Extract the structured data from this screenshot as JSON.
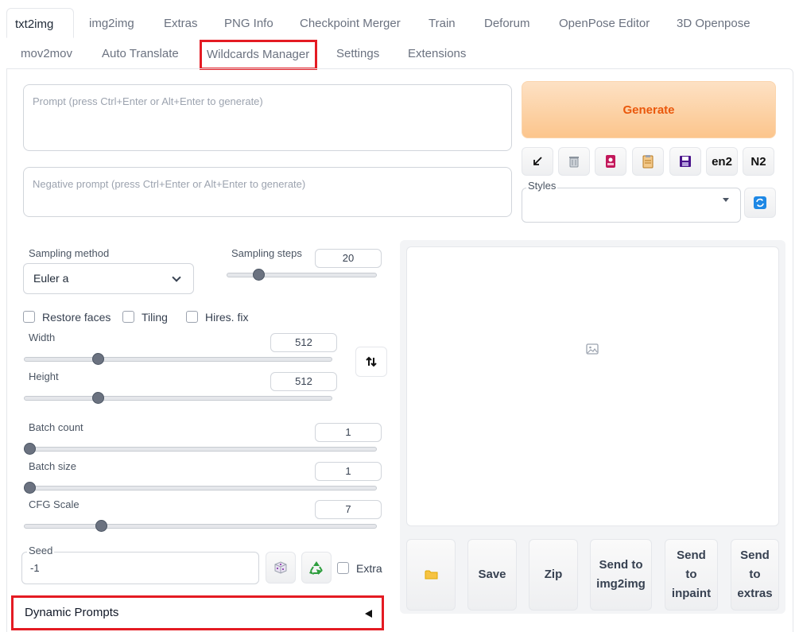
{
  "tabs_row1": [
    "txt2img",
    "img2img",
    "Extras",
    "PNG Info",
    "Checkpoint Merger",
    "Train",
    "Deforum",
    "OpenPose Editor",
    "3D Openpose"
  ],
  "tabs_row2": [
    "mov2mov",
    "Auto Translate",
    "Wildcards Manager",
    "Settings",
    "Extensions"
  ],
  "active_tab": "txt2img",
  "highlighted_tab": "Wildcards Manager",
  "prompt": {
    "placeholder": "Prompt (press Ctrl+Enter or Alt+Enter to generate)"
  },
  "negative_prompt": {
    "placeholder": "Negative prompt (press Ctrl+Enter or Alt+Enter to generate)"
  },
  "generate_label": "Generate",
  "tool_buttons": {
    "read_params": "arrow-icon",
    "clear": "trash-icon",
    "extra_networks": "card-icon",
    "apply_style": "clipboard-icon",
    "save_style": "floppy-icon",
    "en2": "en2",
    "n2": "N2"
  },
  "styles": {
    "label": "Styles",
    "value": ""
  },
  "sampling": {
    "method_label": "Sampling method",
    "method_value": "Euler a",
    "steps_label": "Sampling steps",
    "steps_value": "20",
    "steps_fraction": 0.19
  },
  "checkboxes": {
    "restore_faces": "Restore faces",
    "tiling": "Tiling",
    "hires_fix": "Hires. fix"
  },
  "width": {
    "label": "Width",
    "value": "512",
    "fraction": 0.23
  },
  "height": {
    "label": "Height",
    "value": "512",
    "fraction": 0.23
  },
  "batch_count": {
    "label": "Batch count",
    "value": "1",
    "fraction": 0.0
  },
  "batch_size": {
    "label": "Batch size",
    "value": "1",
    "fraction": 0.0
  },
  "cfg_scale": {
    "label": "CFG Scale",
    "value": "7",
    "fraction": 0.21
  },
  "seed": {
    "label": "Seed",
    "value": "-1",
    "extra_label": "Extra"
  },
  "dynamic_prompts_label": "Dynamic Prompts",
  "output_buttons": {
    "folder": "folder-icon",
    "save": "Save",
    "zip": "Zip",
    "send_img2img": "Send to img2img",
    "send_inpaint": "Send to inpaint",
    "send_extras": "Send to extras"
  },
  "colors": {
    "accent": "#ea580c",
    "highlight": "#e41b23"
  }
}
